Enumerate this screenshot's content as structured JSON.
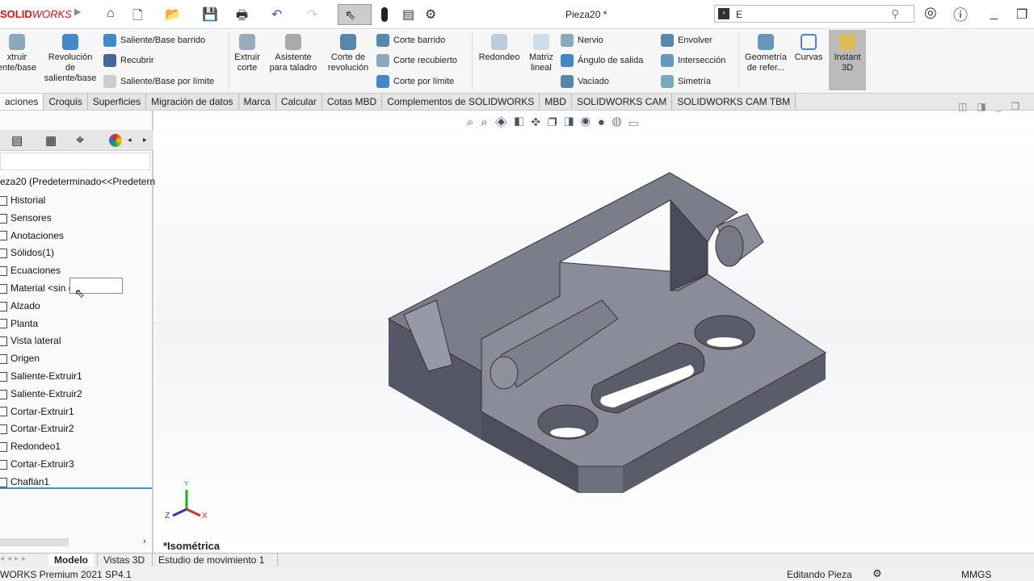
{
  "app": {
    "logo_bold": "SOLID",
    "logo_rest": "WORKS",
    "doc_title": "Pieza20 *"
  },
  "search": {
    "value": "E"
  },
  "ribbon": {
    "extrude": "xtruir\nente/base",
    "revolve": "Revolución\nde\nsaliente/base",
    "swept": "Saliente/Base barrido",
    "loft": "Recubrir",
    "boundary": "Saliente/Base por límite",
    "extrude_cut": "Extruir\ncorte",
    "hole_wizard": "Asistente\npara taladro",
    "revolve_cut": "Corte de\nrevolución",
    "swept_cut": "Corte barrido",
    "lofted_cut": "Corte recubierto",
    "boundary_cut": "Corte por límite",
    "fillet": "Redondeo",
    "linear_pattern": "Matriz\nlineal",
    "rib": "Nervio",
    "draft": "Ángulo de salida",
    "shell": "Vaciado",
    "wrap": "Envolver",
    "intersect": "Intersección",
    "mirror": "Simetría",
    "ref_geom": "Geometría\nde refer...",
    "curves": "Curvas",
    "instant3d": "Instant\n3D"
  },
  "tabs": [
    "aciones",
    "Croquis",
    "Superficies",
    "Migración de datos",
    "Marca",
    "Calcular",
    "Cotas MBD",
    "Complementos de SOLIDWORKS",
    "MBD",
    "SOLIDWORKS CAM",
    "SOLIDWORKS CAM TBM"
  ],
  "tree": {
    "root": "eza20  (Predeterminado<<Predetern",
    "items": [
      "Historial",
      "Sensores",
      "Anotaciones",
      "Sólidos(1)",
      "Ecuaciones",
      "Material <sin especificar>",
      "Alzado",
      "Planta",
      "Vista lateral",
      "Origen",
      "Saliente-Extruir1",
      "Saliente-Extruir2",
      "Cortar-Extruir1",
      "Cortar-Extruir2",
      "Redondeo1",
      "Cortar-Extruir3",
      "Chaflán1"
    ]
  },
  "view": {
    "name": "*Isométrica",
    "axes": {
      "x": "X",
      "y": "Y",
      "z": "Z"
    }
  },
  "bottom_tabs": [
    "Modelo",
    "Vistas 3D",
    "Estudio de movimiento 1"
  ],
  "status": {
    "version": "WORKS Premium 2021 SP4.1",
    "mode": "Editando Pieza",
    "units": "MMGS"
  }
}
